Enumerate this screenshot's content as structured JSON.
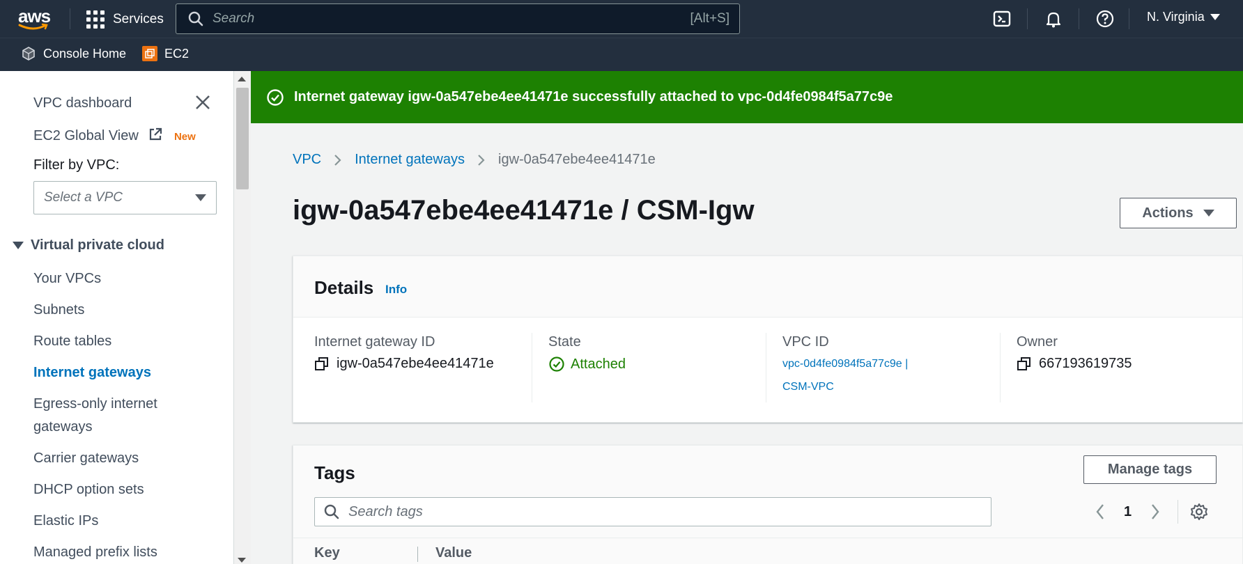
{
  "topbar": {
    "logo": "aws",
    "services_label": "Services",
    "search_placeholder": "Search",
    "search_shortcut": "[Alt+S]",
    "region": "N. Virginia"
  },
  "favorites": [
    {
      "label": "Console Home",
      "icon": "cube-icon"
    },
    {
      "label": "EC2",
      "icon": "ec2-icon"
    }
  ],
  "sidebar": {
    "dashboard": "VPC dashboard",
    "global_view": "EC2 Global View",
    "new_badge": "New",
    "filter_label": "Filter by VPC:",
    "filter_placeholder": "Select a VPC",
    "section": "Virtual private cloud",
    "items": [
      {
        "label": "Your VPCs"
      },
      {
        "label": "Subnets"
      },
      {
        "label": "Route tables"
      },
      {
        "label": "Internet gateways"
      },
      {
        "label": "Egress-only internet"
      },
      {
        "label": "gateways"
      },
      {
        "label": "Carrier gateways"
      },
      {
        "label": "DHCP option sets"
      },
      {
        "label": "Elastic IPs"
      },
      {
        "label": "Managed prefix lists"
      }
    ]
  },
  "flash": {
    "message": "Internet gateway igw-0a547ebe4ee41471e successfully attached to vpc-0d4fe0984f5a77c9e",
    "color": "#1d8102"
  },
  "breadcrumb": {
    "items": [
      "VPC",
      "Internet gateways"
    ],
    "current": "igw-0a547ebe4ee41471e"
  },
  "page": {
    "title": "igw-0a547ebe4ee41471e / CSM-Igw",
    "actions_label": "Actions"
  },
  "details": {
    "heading": "Details",
    "info": "Info",
    "fields": {
      "igw": {
        "label": "Internet gateway ID",
        "value": "igw-0a547ebe4ee41471e"
      },
      "state": {
        "label": "State",
        "value": "Attached"
      },
      "vpc": {
        "label": "VPC ID",
        "value_line1": "vpc-0d4fe0984f5a77c9e |",
        "value_line2": "CSM-VPC"
      },
      "owner": {
        "label": "Owner",
        "value": "667193619735"
      }
    }
  },
  "tags": {
    "heading": "Tags",
    "manage_label": "Manage tags",
    "search_placeholder": "Search tags",
    "page_number": "1",
    "columns": [
      "Key",
      "Value"
    ]
  },
  "colors": {
    "nav_bg": "#232f3e",
    "link": "#0073bb",
    "success": "#1d8102",
    "accent_orange": "#ec7211"
  }
}
